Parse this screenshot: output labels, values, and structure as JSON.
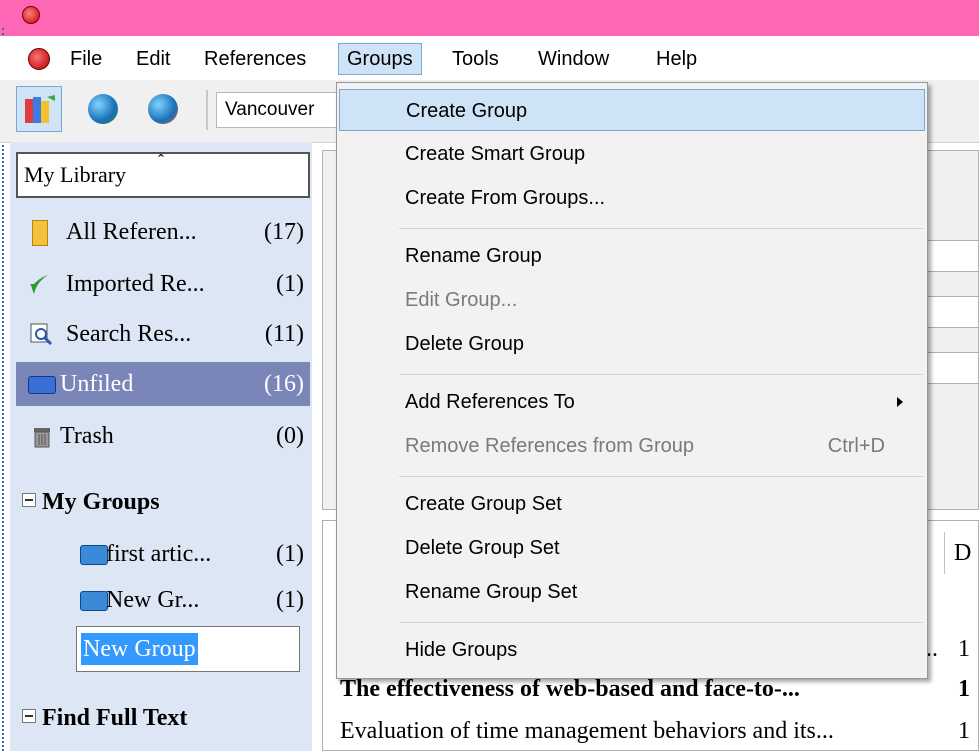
{
  "menubar": {
    "items": [
      "File",
      "Edit",
      "References",
      "Groups",
      "Tools",
      "Window",
      "Help"
    ]
  },
  "toolbar": {
    "style": "Vancouver"
  },
  "library": {
    "header": "My Library",
    "items": [
      {
        "label": "All Referen...",
        "count": "(17)"
      },
      {
        "label": "Imported Re...",
        "count": "(1)"
      },
      {
        "label": "Search Res...",
        "count": "(11)"
      },
      {
        "label": "Unfiled",
        "count": "(16)"
      },
      {
        "label": "Trash",
        "count": "(0)"
      }
    ],
    "my_groups": "My Groups",
    "groups": [
      {
        "label": "first artic...",
        "count": "(1)"
      },
      {
        "label": "New Gr...",
        "count": "(1)"
      }
    ],
    "new_group_edit": "New Group",
    "find_full_text": "Find Full Text"
  },
  "references": {
    "column_header": "D",
    "rows": [
      {
        "title": "",
        "num": "1"
      },
      {
        "title": "The effectiveness of web-based and face-to-...",
        "num": "1"
      },
      {
        "title": "Evaluation of time management behaviors and its...",
        "num": "1"
      }
    ],
    "row0_ellipsis": ".."
  },
  "groups_menu": {
    "items": [
      {
        "label": "Create Group"
      },
      {
        "label": "Create Smart Group"
      },
      {
        "label": "Create From Groups..."
      },
      {
        "label": "Rename Group"
      },
      {
        "label": "Edit Group..."
      },
      {
        "label": "Delete Group"
      },
      {
        "label": "Add References To"
      },
      {
        "label": "Remove References from Group",
        "shortcut": "Ctrl+D"
      },
      {
        "label": "Create Group Set"
      },
      {
        "label": "Delete Group Set"
      },
      {
        "label": "Rename Group Set"
      },
      {
        "label": "Hide Groups"
      }
    ]
  }
}
